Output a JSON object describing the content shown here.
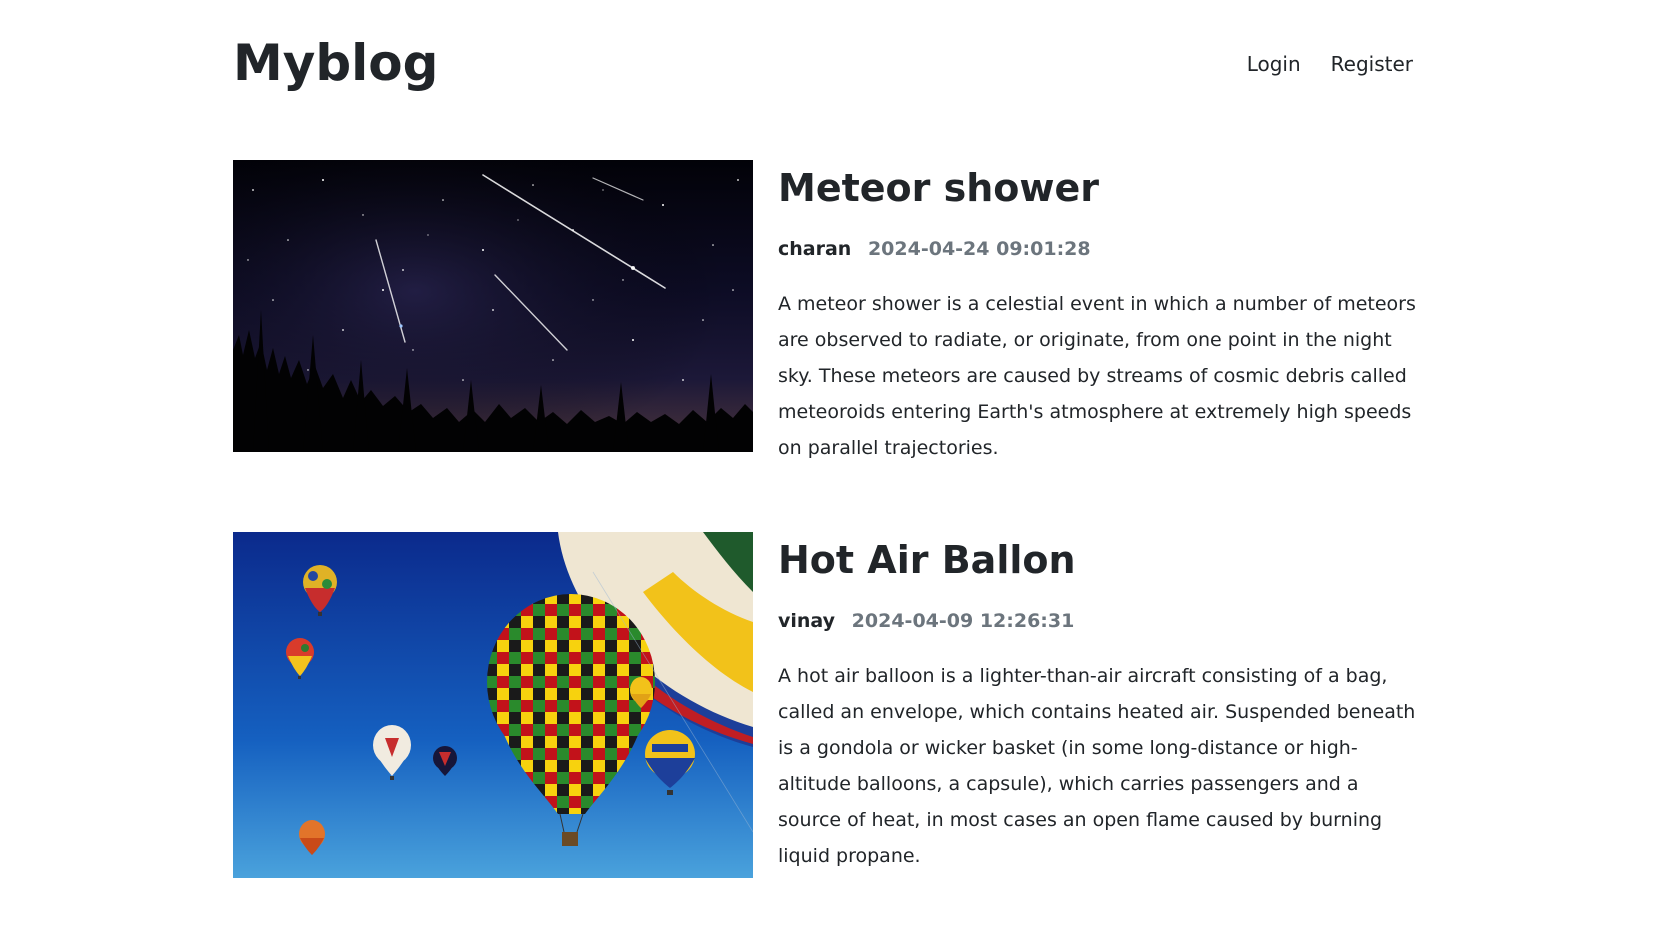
{
  "header": {
    "brand": "Myblog",
    "nav": [
      {
        "label": "Login"
      },
      {
        "label": "Register"
      }
    ]
  },
  "posts": [
    {
      "title": "Meteor shower",
      "author": "charan",
      "date": "2024-04-24 09:01:28",
      "excerpt": "A meteor shower is a celestial event in which a number of meteors are observed to radiate, or originate, from one point in the night sky. These meteors are caused by streams of cosmic debris called meteoroids entering Earth's atmosphere at extremely high speeds on parallel trajectories.",
      "image": "meteor-shower-night-sky"
    },
    {
      "title": "Hot Air Ballon",
      "author": "vinay",
      "date": "2024-04-09 12:26:31",
      "excerpt": "A hot air balloon is a lighter-than-air aircraft consisting of a bag, called an envelope, which contains heated air. Suspended beneath is a gondola or wicker basket (in some long-distance or high-altitude balloons, a capsule), which carries passengers and a source of heat, in most cases an open flame caused by burning liquid propane.",
      "image": "hot-air-balloons-blue-sky"
    }
  ]
}
